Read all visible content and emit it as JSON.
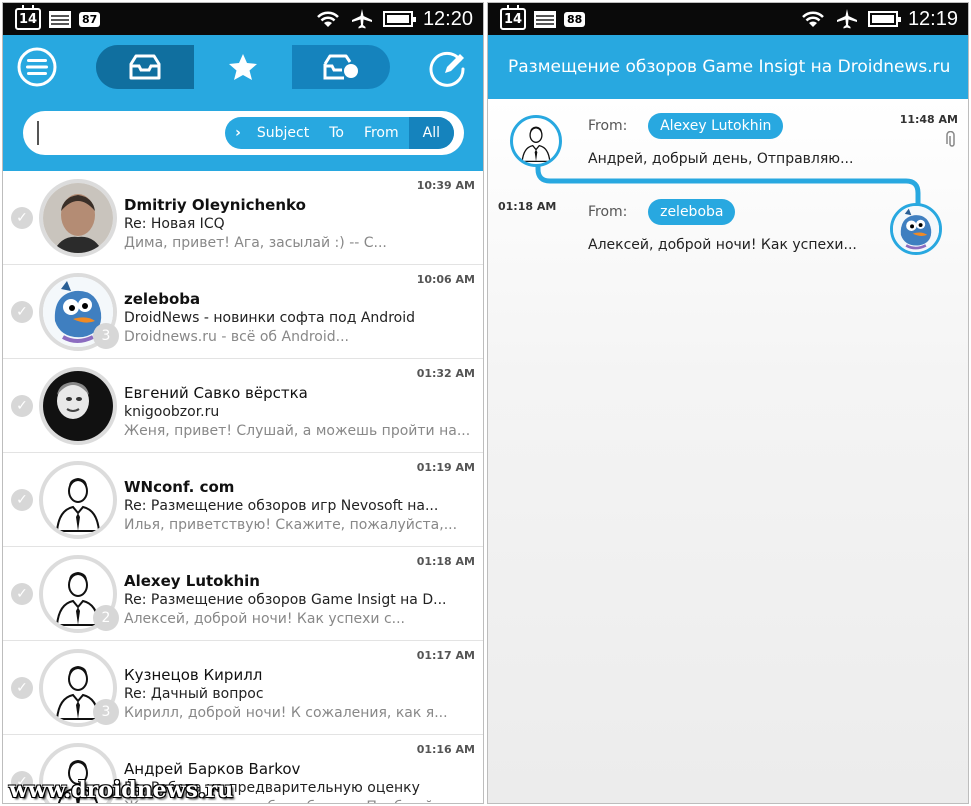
{
  "left": {
    "status": {
      "cal_day": "14",
      "notif_count": "87",
      "time": "12:20"
    },
    "search": {
      "filters": [
        "Subject",
        "To",
        "From",
        "All"
      ]
    },
    "messages": [
      {
        "time": "10:39 AM",
        "name": "Dmitriy Oleynichenko",
        "subject_prefix": "Re: ",
        "subject": "Новая ICQ",
        "preview": "Дима, привет! Ага, засылай :) -- С...",
        "count": "",
        "avatar": "photo-man"
      },
      {
        "time": "10:06 AM",
        "name": "zeleboba",
        "subject_prefix": "DroidNews - ",
        "subject": "новинки софта под Android",
        "preview": "Droidnews.ru - всё об Android...",
        "count": "3",
        "avatar": "monster"
      },
      {
        "time": "01:32 AM",
        "name": "Евгений Савко вёрстка",
        "subject_prefix": "",
        "subject": "knigoobzor.ru",
        "preview": "Женя, привет! Слушай, а можешь пройти на...",
        "count": "",
        "avatar": "photo-dark"
      },
      {
        "time": "01:19 AM",
        "name": "WNconf. com",
        "subject_prefix": "Re: ",
        "subject": "Размещение обзоров игр Nevosoft на...",
        "preview": "Илья, приветствую! Скажите, пожалуйста,...",
        "count": "",
        "avatar": "default-person"
      },
      {
        "time": "01:18 AM",
        "name": "Alexey Lutokhin",
        "subject_prefix": "Re: ",
        "subject": "Размещение обзоров Game Insigt на D...",
        "preview": "Алексей, доброй ночи! Как успехи с...",
        "count": "2",
        "avatar": "default-person"
      },
      {
        "time": "01:17 AM",
        "name": "Кузнецов Кирилл",
        "subject_prefix": "Re: ",
        "subject": "Дачный вопрос",
        "preview": "Кирилл, доброй ночи! К сожаления, как я...",
        "count": "3",
        "avatar": "default-person"
      },
      {
        "time": "01:16 AM",
        "name": "Андрей Барков Barkov",
        "subject_prefix": "Re: ",
        "subject": "Работа на предварительную оценку",
        "preview": "Жду от тогда от тебя наброска. Пообщайся...",
        "count": "",
        "avatar": "default-person"
      }
    ],
    "watermark": "www.droidnews.ru"
  },
  "right": {
    "status": {
      "cal_day": "14",
      "notif_count": "88",
      "time": "12:19"
    },
    "title": "Размещение обзоров Game Insigt на Droidnews.ru",
    "thread": [
      {
        "from_label": "From:",
        "from": "Alexey Lutokhin",
        "preview": "Андрей, добрый день, Отправляю...",
        "time": "11:48 AM",
        "avatar": "default-person",
        "attachment_icon": "paperclip-icon"
      },
      {
        "from_label": "From:",
        "from": "zeleboba",
        "preview": "Алексей, доброй ночи! Как успехи...",
        "time": "01:18 AM",
        "avatar": "monster"
      }
    ]
  },
  "colors": {
    "accent": "#28a8e0",
    "accent_dark": "#1583bd"
  }
}
